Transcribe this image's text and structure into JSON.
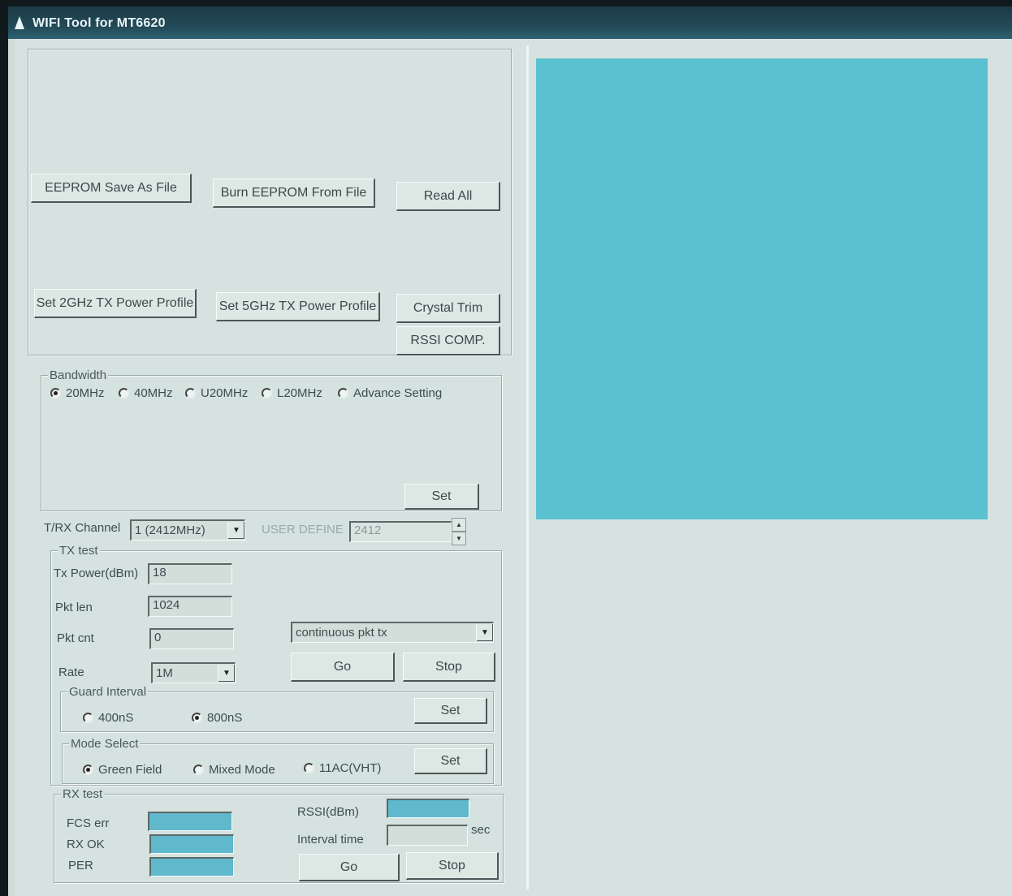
{
  "window": {
    "title": "WIFI Tool for MT6620"
  },
  "eeprom": {
    "save_label": "EEPROM Save As File",
    "burn_label": "Burn EEPROM From File",
    "read_all_label": "Read All"
  },
  "profiles": {
    "set_2g_label": "Set 2GHz TX Power Profile",
    "set_5g_label": "Set 5GHz TX Power Profile",
    "crystal_trim_label": "Crystal Trim",
    "rssi_comp_label": "RSSI COMP."
  },
  "bandwidth": {
    "label": "Bandwidth",
    "options": [
      "20MHz",
      "40MHz",
      "U20MHz",
      "L20MHz",
      "Advance Setting"
    ],
    "selected": "20MHz",
    "set_label": "Set"
  },
  "channel": {
    "label": "T/RX Channel",
    "value": "1 (2412MHz)",
    "user_define_label": "USER DEFINE",
    "user_define_value": "2412"
  },
  "tx_test": {
    "label": "TX test",
    "tx_power_label": "Tx Power(dBm)",
    "tx_power_value": "18",
    "pkt_len_label": "Pkt len",
    "pkt_len_value": "1024",
    "pkt_cnt_label": "Pkt cnt",
    "pkt_cnt_value": "0",
    "mode_value": "continuous pkt tx",
    "rate_label": "Rate",
    "rate_value": "1M",
    "go_label": "Go",
    "stop_label": "Stop"
  },
  "guard_interval": {
    "label": "Guard Interval",
    "options": [
      "400nS",
      "800nS"
    ],
    "selected": "800nS",
    "set_label": "Set"
  },
  "mode_select": {
    "label": "Mode Select",
    "options": [
      "Green Field",
      "Mixed Mode",
      "11AC(VHT)"
    ],
    "selected": "Green Field",
    "set_label": "Set"
  },
  "rx_test": {
    "label": "RX test",
    "fcs_err_label": "FCS err",
    "rx_ok_label": "RX OK",
    "per_label": "PER",
    "rssi_label": "RSSI(dBm)",
    "interval_label": "Interval time",
    "interval_unit": "sec",
    "go_label": "Go",
    "stop_label": "Stop"
  },
  "colors": {
    "display_panel": "#5bc0d0",
    "readout_fill": "#5fb8cc",
    "window_bg": "#d6e2df"
  }
}
